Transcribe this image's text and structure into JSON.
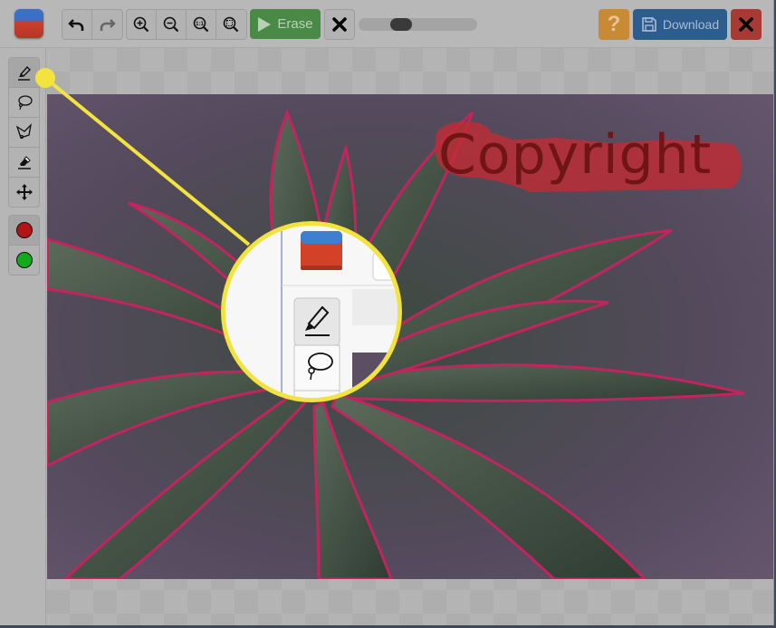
{
  "toolbar": {
    "logo_icon": "eraser-app-icon",
    "undo_label": "Undo",
    "redo_label": "Redo",
    "zoom_in_label": "Zoom in",
    "zoom_out_label": "Zoom out",
    "zoom_actual_label": "1:1",
    "zoom_fit_label": "Fit",
    "erase_label": "Erase",
    "clear_label": "Clear",
    "brush_size_fraction": 0.33,
    "help_label": "?",
    "download_label": "Download",
    "close_label": "Close"
  },
  "sidebar": {
    "tools": [
      {
        "name": "marker",
        "icon": "marker-icon",
        "active": true
      },
      {
        "name": "lasso",
        "icon": "lasso-icon",
        "active": false
      },
      {
        "name": "polygon-lasso",
        "icon": "polygon-lasso-icon",
        "active": false
      },
      {
        "name": "eraser",
        "icon": "eraser-icon",
        "active": false
      },
      {
        "name": "move",
        "icon": "move-icon",
        "active": false
      }
    ],
    "colors": [
      {
        "name": "remove",
        "hex": "#b31414"
      },
      {
        "name": "keep",
        "hex": "#14a81c"
      }
    ]
  },
  "canvas": {
    "watermark_text": "Copyright",
    "mark_color": "#c42a33"
  },
  "callout": {
    "color": "#f2e33f",
    "magnified_target": "marker-tool"
  }
}
